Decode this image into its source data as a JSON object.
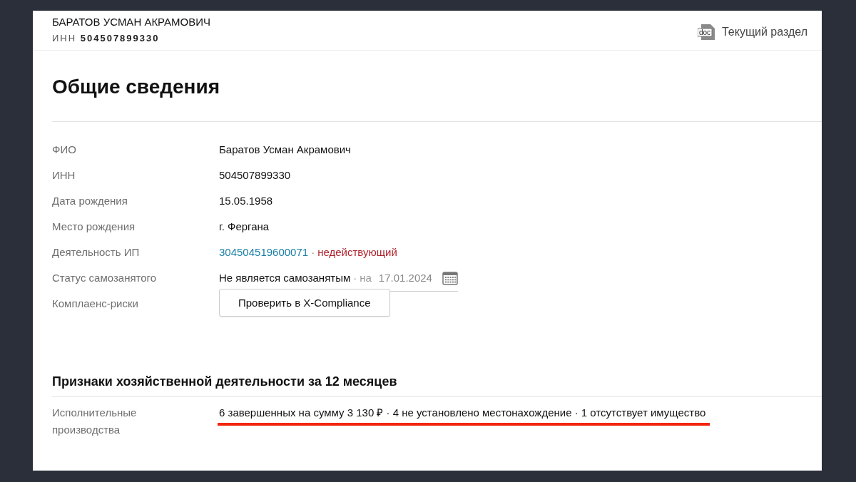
{
  "header": {
    "name": "БАРАТОВ УСМАН АКРАМОВИЧ",
    "inn_label": "ИНН",
    "inn": "504507899330",
    "icon_label": "doc",
    "current_section": "Текущий раздел"
  },
  "title": "Общие сведения",
  "fields": [
    {
      "kind": "text",
      "label": "ФИО",
      "value": "Баратов Усман Акрамович"
    },
    {
      "kind": "text",
      "label": "ИНН",
      "value": "504507899330"
    },
    {
      "kind": "text",
      "label": "Дата рождения",
      "value": "15.05.1958"
    },
    {
      "kind": "text",
      "label": "Место рождения",
      "value": "г. Фергана"
    },
    {
      "kind": "activity",
      "label": "Деятельность ИП",
      "number": "304504519600071",
      "separator": "·",
      "status": "недействующий"
    },
    {
      "kind": "dated",
      "label": "Статус самозанятого",
      "value": "Не является самозанятым",
      "separator": "·",
      "date_prefix": "на",
      "date": "17.01.2024"
    },
    {
      "kind": "button",
      "label": "Комплаенс-риски",
      "button": "Проверить в X-Compliance"
    }
  ],
  "section": {
    "title": "Признаки хозяйственной деятельности за 12 месяцев",
    "rows": [
      {
        "label": "Исполнительные производства",
        "value": "6 завершенных на сумму 3 130 ₽ · 4 не установлено местонахождение · 1 отсутствует имущество",
        "highlighted": true
      }
    ]
  }
}
